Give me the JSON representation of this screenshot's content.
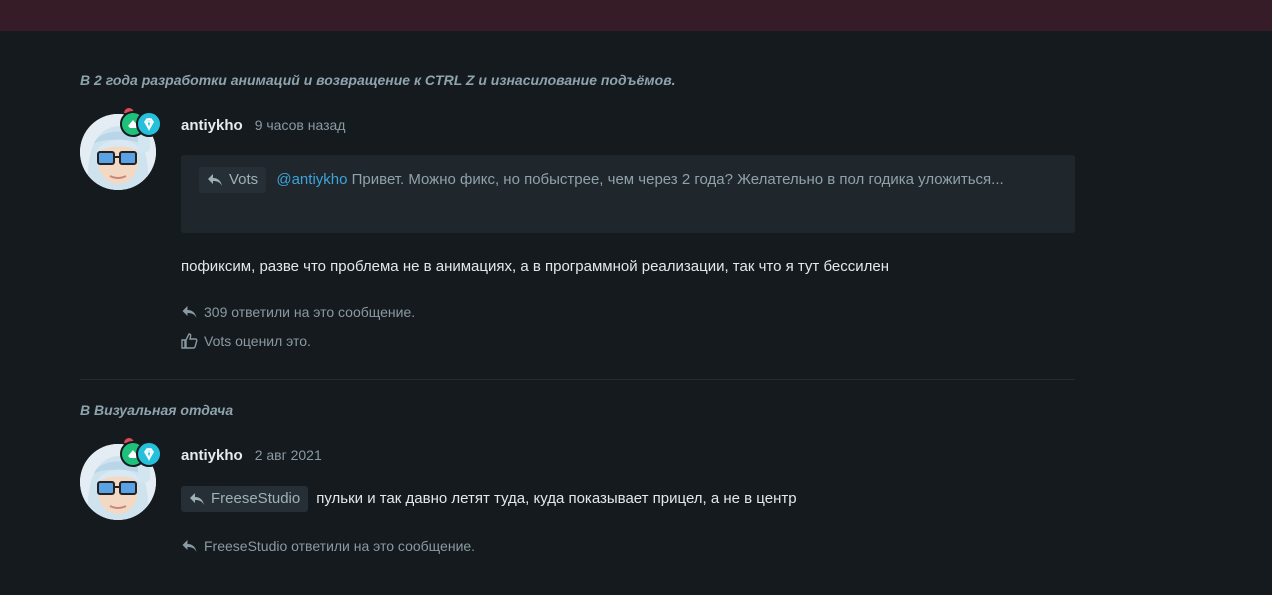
{
  "posts": [
    {
      "context_prefix": "В",
      "context_title": "2 года разработки анимаций и возвращение к CTRL Z и изнасилование подъёмов.",
      "username": "antiykho",
      "timestamp": "9 часов назад",
      "quote": {
        "author": "Vots",
        "mention": "@antiykho",
        "text": "Привет. Можно фикс, но побыстрее, чем через 2 года? Желательно в пол годика уложиться..."
      },
      "message": "пофиксим, разве что проблема не в анимациях, а в программной реализации, так что я тут бессилен",
      "replies_text": "309 ответили на это сообщение.",
      "likes_text": "Vots оценил это."
    },
    {
      "context_prefix": "В",
      "context_title": "Визуальная отдача",
      "username": "antiykho",
      "timestamp": "2 авг 2021",
      "reply_tag": "FreeseStudio",
      "message": "пульки и так давно летят туда, куда показывает прицел, а не в центр",
      "replies_text": "FreeseStudio ответили на это сообщение."
    }
  ],
  "colors": {
    "topbar": "#351c26",
    "background": "#151a1e",
    "mention": "#3ea3da",
    "badge_green": "#1fc07b",
    "badge_cyan": "#27c0dc"
  }
}
